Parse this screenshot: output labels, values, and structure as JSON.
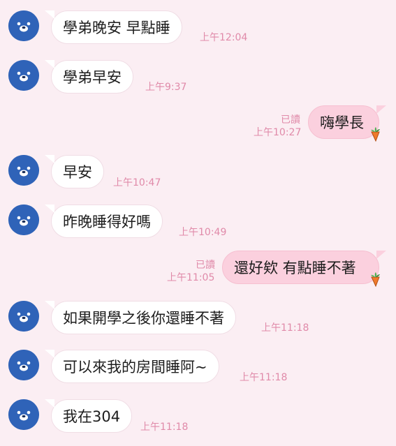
{
  "colors": {
    "background": "#fbeef3",
    "incoming_bubble": "#ffffff",
    "outgoing_bubble": "#fbd0de",
    "timestamp": "#e08aa9",
    "avatar": "#2f63b8"
  },
  "messages": [
    {
      "text": "學弟晚安 早點睡",
      "time": "上午12:04"
    },
    {
      "text": "學弟早安",
      "time": "上午9:37"
    },
    {
      "text": "嗨學長",
      "time": "上午10:27",
      "read": "已讀"
    },
    {
      "text": "早安",
      "time": "上午10:47"
    },
    {
      "text": "昨晚睡得好嗎",
      "time": "上午10:49"
    },
    {
      "text": "還好欸 有點睡不著",
      "time": "上午11:05",
      "read": "已讀"
    },
    {
      "text": "如果開學之後你還睡不著",
      "time": "上午11:18"
    },
    {
      "text": "可以來我的房間睡阿~",
      "time": "上午11:18"
    },
    {
      "text": "我在304",
      "time": "上午11:18"
    }
  ]
}
